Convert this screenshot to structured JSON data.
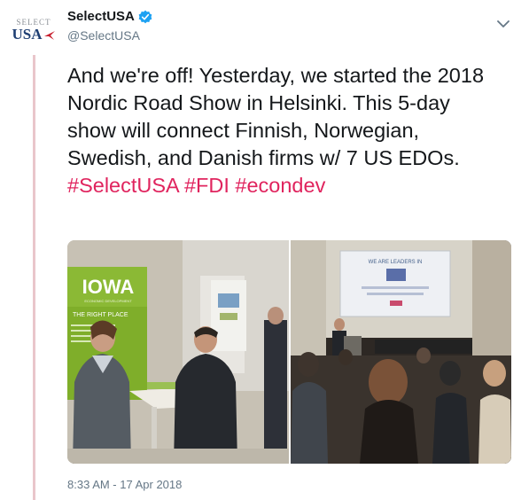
{
  "account": {
    "display_name": "SelectUSA",
    "handle": "@SelectUSA",
    "verified": true,
    "avatar_top": "SELECT",
    "avatar_bottom": "USA"
  },
  "tweet": {
    "text_before": "And we're off! Yesterday, we started the 2018 Nordic Road Show in Helsinki. This 5-day show will connect Finnish, Norwegian, Swedish, and Danish firms w/ 7 US EDOs. ",
    "hashtags": [
      "#SelectUSA",
      "#FDI",
      "#econdev"
    ],
    "timestamp": "8:33 AM - 17 Apr 2018"
  },
  "media": {
    "left_photo": {
      "banner_title": "IOWA",
      "banner_subtitle": "ECONOMIC DEVELOPMENT",
      "banner_tagline": "THE RIGHT PLACE"
    },
    "right_photo": {
      "screen_title": "WE ARE LEADERS IN"
    }
  },
  "colors": {
    "hashtag": "#e0245e",
    "thread_line": "#e9c6cb",
    "verified": "#1da1f2",
    "iowa_banner": "#7fae2a"
  },
  "icons": [
    "verified-badge-icon",
    "chevron-down-icon"
  ]
}
